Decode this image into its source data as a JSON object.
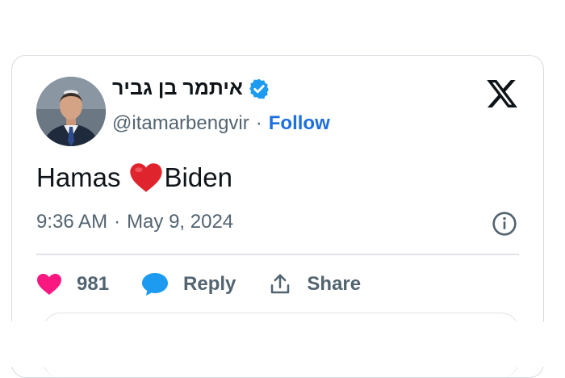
{
  "tweet": {
    "author_name": "איתמר בן גביר",
    "handle": "@itamarbengvir",
    "separator": "·",
    "follow_label": "Follow",
    "text_before": "Hamas",
    "text_after": "Biden",
    "time": "9:36 AM",
    "date": "May 9, 2024",
    "likes": "981",
    "reply_label": "Reply",
    "share_label": "Share"
  },
  "colors": {
    "verified": "#1d9bf0",
    "follow": "#1d6fe0",
    "like_heart": "#f91880",
    "reply_bubble": "#1d9bf0",
    "emoji_heart": "#e0242e"
  },
  "icons": [
    "verified-badge-icon",
    "x-logo-icon",
    "red-heart-emoji-icon",
    "info-icon",
    "like-heart-icon",
    "reply-bubble-icon",
    "share-icon"
  ]
}
